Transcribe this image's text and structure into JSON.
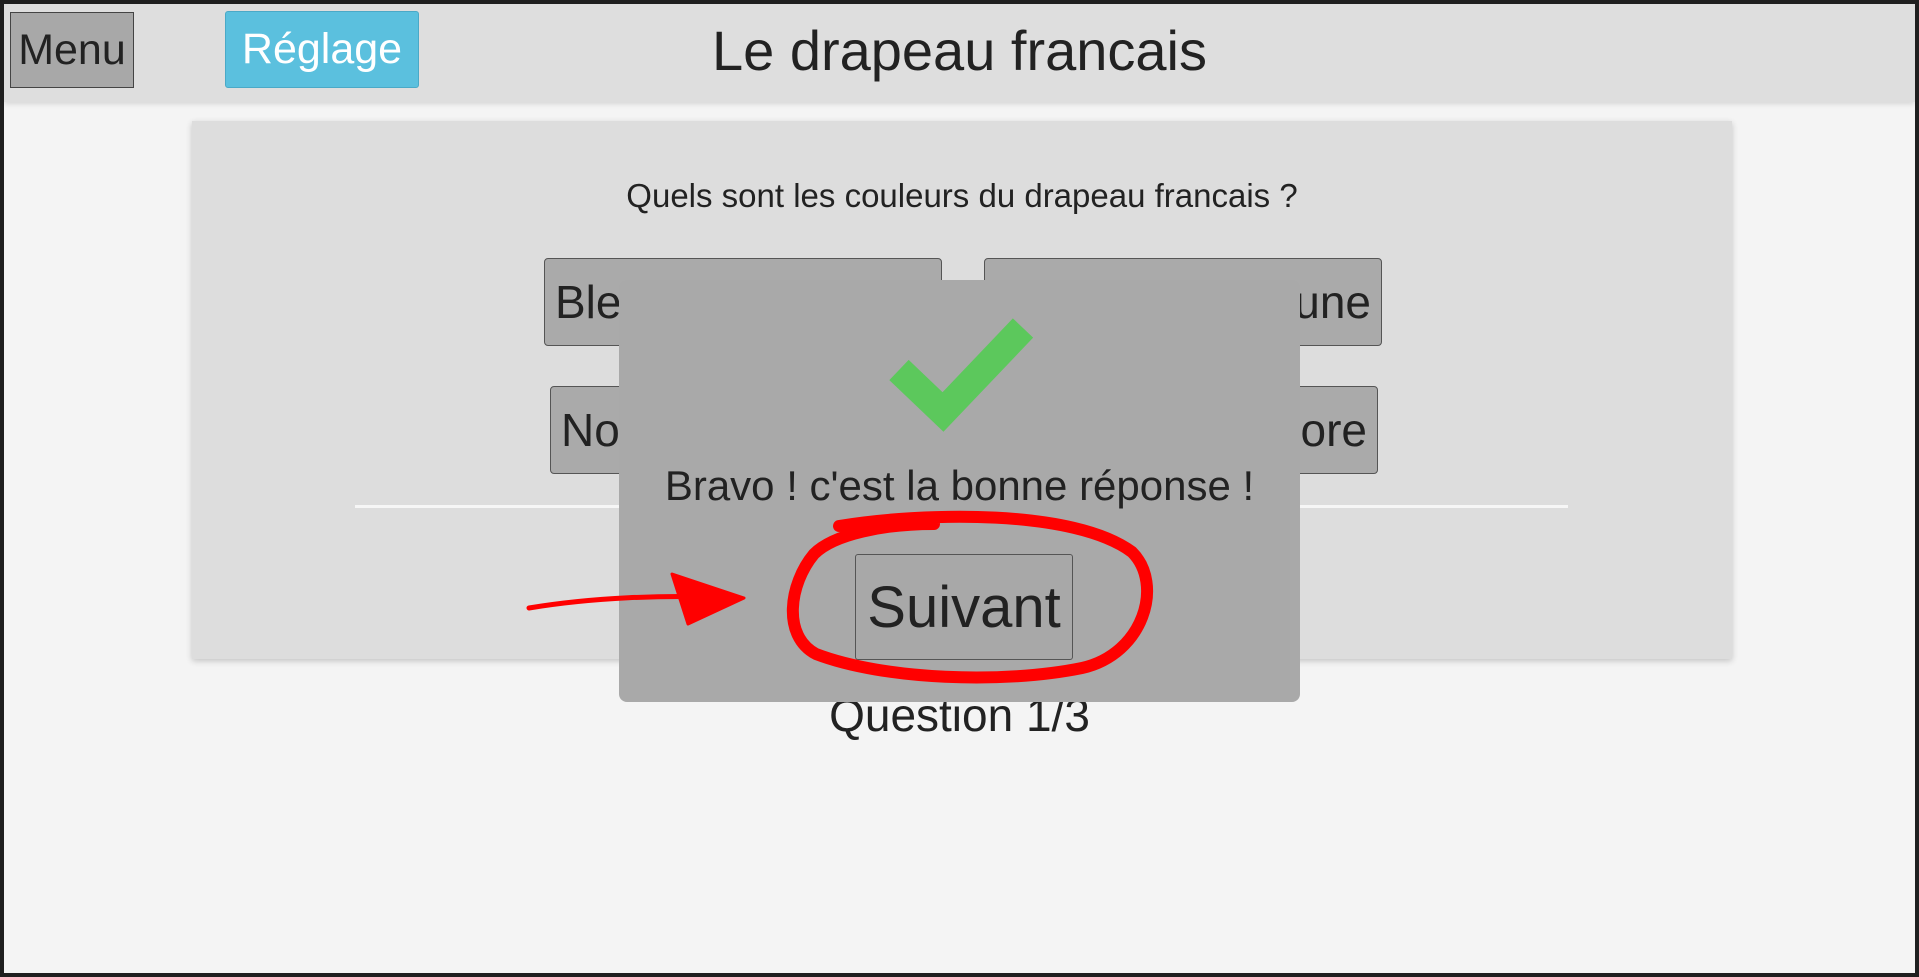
{
  "header": {
    "menu_label": "Menu",
    "settings_label": "Réglage",
    "title": "Le drapeau francais"
  },
  "quiz": {
    "question": "Quels sont les couleurs du drapeau francais ?",
    "answers": [
      {
        "visible_text": "Ble",
        "visible_text_end": "une"
      },
      {
        "visible_text": "No",
        "visible_text_end": "ore"
      }
    ],
    "progress": "Question 1/3"
  },
  "modal": {
    "message": "Bravo ! c'est la bonne réponse !",
    "next_label": "Suivant",
    "icon": "checkmark-icon"
  },
  "colors": {
    "header_bg": "#dedede",
    "settings_button": "#5bc0de",
    "check_green": "#5cc85c",
    "annotation_red": "#ff0000",
    "modal_bg": "#a9a9a9"
  }
}
